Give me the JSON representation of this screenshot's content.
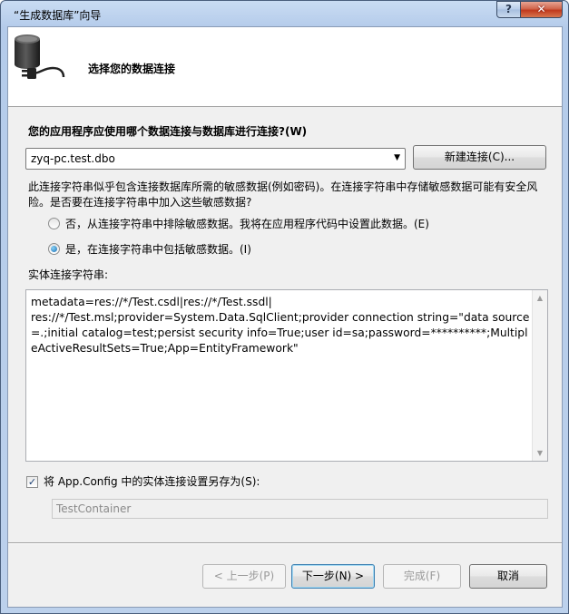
{
  "window": {
    "title": "“生成数据库”向导",
    "help_label": "?",
    "close_label": "✕"
  },
  "banner": {
    "title": "选择您的数据连接"
  },
  "connection": {
    "question": "您的应用程序应使用哪个数据连接与数据库进行连接?(W)",
    "selected": "zyq-pc.test.dbo",
    "new_button": "新建连接(C)..."
  },
  "sensitive": {
    "paragraph": "此连接字符串似乎包含连接数据库所需的敏感数据(例如密码)。在连接字符串中存储敏感数据可能有安全风险。是否要在连接字符串中加入这些敏感数据?",
    "option_exclude": "否，从连接字符串中排除敏感数据。我将在应用程序代码中设置此数据。(E)",
    "option_include": "是，在连接字符串中包括敏感数据。(I)",
    "selected_option": "include"
  },
  "entity": {
    "label": "实体连接字符串:",
    "value": "metadata=res://*/Test.csdl|res://*/Test.ssdl|\nres://*/Test.msl;provider=System.Data.SqlClient;provider connection string=\"data source=.;initial catalog=test;persist security info=True;user id=sa;password=**********;MultipleActiveResultSets=True;App=EntityFramework\""
  },
  "save": {
    "checked": true,
    "label": "将 App.Config 中的实体连接设置另存为(S):",
    "value": "TestContainer"
  },
  "footer": {
    "prev": "< 上一步(P)",
    "next": "下一步(N) >",
    "finish": "完成(F)",
    "cancel": "取消"
  }
}
